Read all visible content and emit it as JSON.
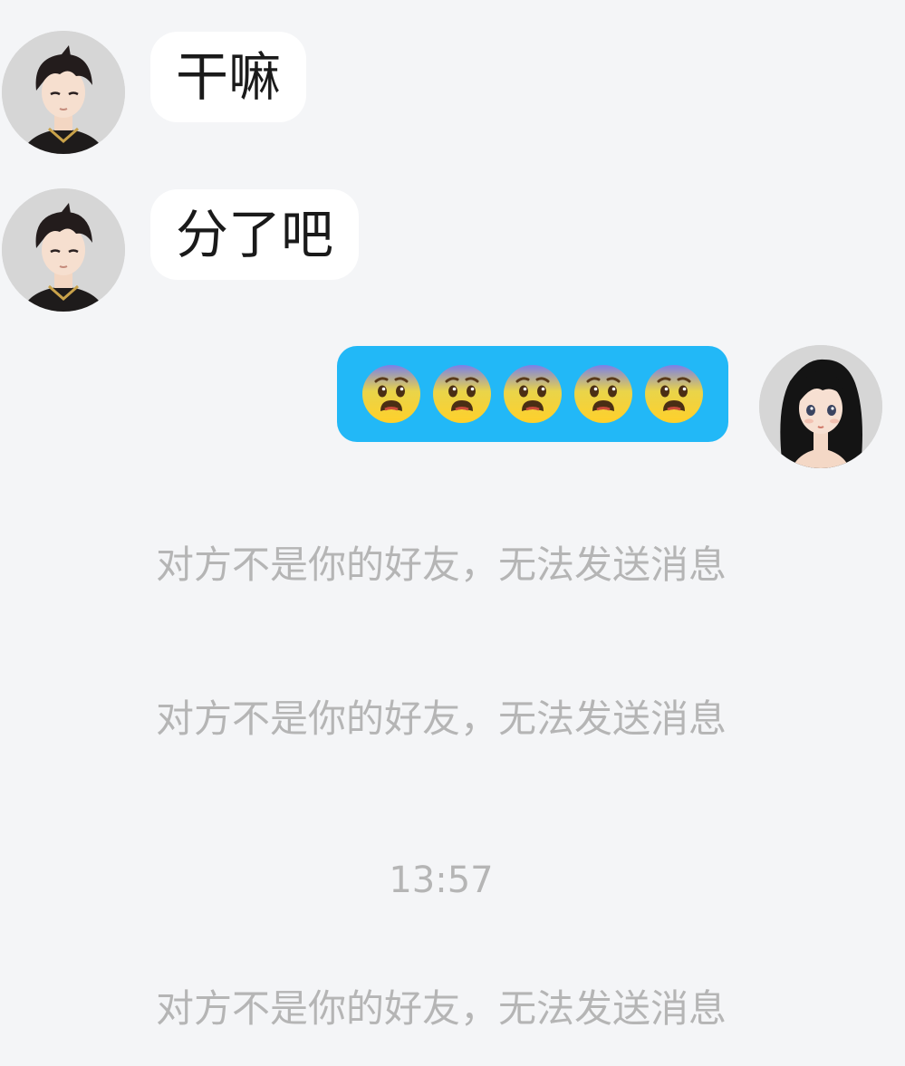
{
  "messages": [
    {
      "sender": "them",
      "text": "干嘛"
    },
    {
      "sender": "them",
      "text": "分了吧"
    },
    {
      "sender": "me",
      "emojis": [
        "anxious-face-icon",
        "anxious-face-icon",
        "anxious-face-icon",
        "anxious-face-icon",
        "anxious-face-icon"
      ]
    }
  ],
  "system_notices": [
    "对方不是你的好友，无法发送消息",
    "对方不是你的好友，无法发送消息",
    "对方不是你的好友，无法发送消息"
  ],
  "timestamp": "13:57",
  "colors": {
    "background": "#f4f5f7",
    "incoming_bubble": "#ffffff",
    "outgoing_bubble": "#22b8f7",
    "system_text": "#b5b5b5"
  }
}
